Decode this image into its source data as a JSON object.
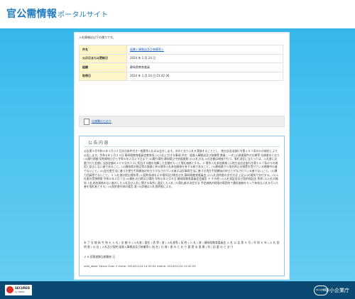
{
  "site": {
    "title_main": "官公需情報",
    "title_sub": "ポータルサイト"
  },
  "page": {
    "intro": "入札情報は以下の通りです。"
  },
  "info_rows": [
    {
      "label": "件名",
      "value": "図書入庫搬送及び装備等入",
      "link": true
    },
    {
      "label": "公示日または更新日",
      "value": "2024 年 1 月 24 日",
      "link": false
    },
    {
      "label": "組織",
      "value": "静岡県教育委員",
      "link": false
    },
    {
      "label": "取得日",
      "value": "2024 年 1 月 24 日 21:42:36",
      "link": false
    }
  ],
  "doc": {
    "link_label": "仕様書のとおり",
    "icon": "document-icon"
  },
  "notice": {
    "title": "公告内容",
    "body1": "公告第５号令和６年１月２４日次点条件付き一般競争入札の公告をします。次のとおり入札を実施することとし、地方自治法施行令第１６７条の６の規定により公告します。令和６年１月２４日 静岡県教育委員会教育長 (1)入札に付する事項 件名：図書入庫搬送及び装備等 数量：一式 (2)調達案件の仕様等 仕様書のとおり (3)履行期間 契約締結日から令和６年３月２９日まで (4)履行場所 静岡県立中央図書館 (5)入札方法 入札金額は総価で行う。落札決定に当たっては、入札書に記載された金額に当該金額の１００分の１０に相当する額を加算した金額をもって落札価格とする。２ 競争入札参加資格 (1)地方自治法施行令第１６７条の４の規定に該当しない者であること。(2)静岡県の物品等の調達に係る競争入札参加資格を有する者であること。(3)静岡県から指名停止の措置を受けている期間中の者でないこと。(4)会社更生法に基づき更生手続開始の申立てがなされている者又は民事再生法に基づき再生手続開始の申立てがなされている者でないこと。(5)暴力団員等でないこと。３ 入札書の提出場所等 (1)契約条項を示す場所及び問合せ先 静岡県教育委員会 (2)入札説明書の交付方法 上記(1)の場所で交付する。(3)入札書の受領期限 令和６年２月７日 (4)開札の日時及び場所 令和６年２月８日 静岡県教育委員会会議室 ４ その他 (1)入札保証金及び契約保証金 免除 (2)入札の無効 入札参加資格のない者のした入札及び入札に関する条件に違反した入札 (3)落札者の決定方法 予定価格の制限の範囲内で最低価格をもって有効な入札を行った者を落札者とする。(4)契約書作成の要否 要 (5)詳細は入札説明書による。",
    "body2": "本 了 全 線 新 令 和 ６ 入 札 ( 金 額 ￥ ) 入札書 ( 委任 ) 状 等 ( 書 ) 入札書等 ( 契 約 ) 入 札 ( 書 ) 静岡県教育委員会 入 札 公 告 第 ５ 号 ( 令 和 ６ 年 ) 入 札 説 明 書 ( 公 告 ) 入札及び契約 図書入庫搬送及び装備等入 指 名 ( 仕 様 ) 書 の と お り 要 提 出 書 類 ( 別 ) 記 載 の と お り",
    "body3": "２ 8 見積書類当期最終 日",
    "meta": "scdt_label: Epson Scan 2 ctime: 2024/01/24 14:35:04 mtime: 2024/01/24 15:42:55"
  },
  "footer": {
    "badge_title": "SECURED",
    "badge_sub": "by SPINS",
    "agency_logo": "中小企業庁",
    "agency_name": "中小企業庁"
  }
}
